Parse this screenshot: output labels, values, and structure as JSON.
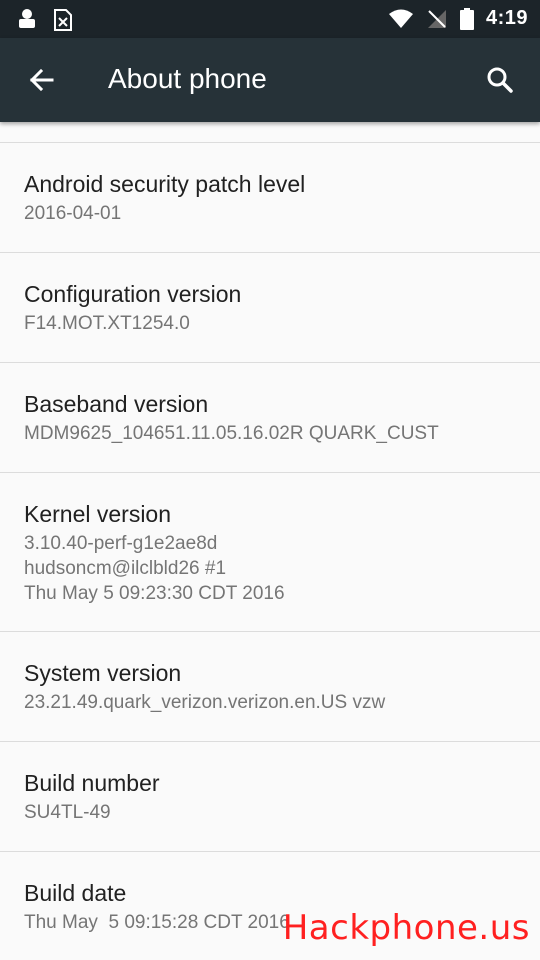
{
  "status_bar": {
    "time": "4:19",
    "left_icons": [
      "android-notification-icon",
      "sim-error-icon"
    ],
    "right_icons": [
      "wifi-icon",
      "no-signal-icon",
      "battery-icon"
    ]
  },
  "toolbar": {
    "title": "About phone",
    "back_icon": "arrow-back-icon",
    "search_icon": "search-icon"
  },
  "items": [
    {
      "title": "Android security patch level",
      "lines": [
        "2016-04-01"
      ]
    },
    {
      "title": "Configuration version",
      "lines": [
        "F14.MOT.XT1254.0"
      ]
    },
    {
      "title": "Baseband version",
      "lines": [
        "MDM9625_104651.11.05.16.02R QUARK_CUST"
      ]
    },
    {
      "title": "Kernel version",
      "lines": [
        "3.10.40-perf-g1e2ae8d",
        "hudsoncm@ilclbld26 #1",
        "Thu May 5 09:23:30 CDT 2016"
      ]
    },
    {
      "title": "System version",
      "lines": [
        "23.21.49.quark_verizon.verizon.en.US vzw"
      ]
    },
    {
      "title": "Build number",
      "lines": [
        "SU4TL-49"
      ]
    },
    {
      "title": "Build date",
      "lines": [
        "Thu May  5 09:15:28 CDT 2016"
      ]
    }
  ],
  "watermark": "Hackphone.us",
  "colors": {
    "status_bar": "#1c2429",
    "toolbar": "#263238",
    "background": "#fafafa",
    "title_text": "#212121",
    "subtitle_text": "#757575",
    "watermark": "#ff2020"
  }
}
